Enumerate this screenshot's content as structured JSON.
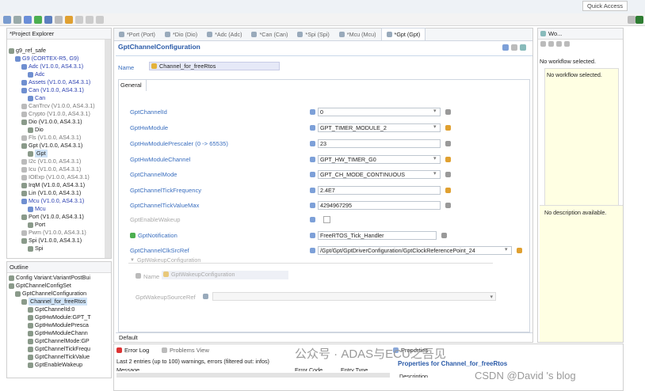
{
  "toolbar": {
    "quick_access": "Quick Access"
  },
  "project_explorer": {
    "title": "*Project Explorer",
    "items": [
      {
        "label": "g9_ref_safe",
        "indent": 0,
        "cls": ""
      },
      {
        "label": "G9 (CORTEX-R5, G9)",
        "indent": 1,
        "cls": "blue"
      },
      {
        "label": "Adc (V1.0.0, AS4.3.1)",
        "indent": 2,
        "cls": "blue"
      },
      {
        "label": "Adc",
        "indent": 3,
        "cls": "blue"
      },
      {
        "label": "Assets (V1.0.0, AS4.3.1)",
        "indent": 2,
        "cls": "blue"
      },
      {
        "label": "Can (V1.0.0, AS4.3.1)",
        "indent": 2,
        "cls": "blue"
      },
      {
        "label": "Can",
        "indent": 3,
        "cls": "blue"
      },
      {
        "label": "CanTrcv (V1.0.0, AS4.3.1)",
        "indent": 2,
        "cls": "gray"
      },
      {
        "label": "Crypto (V1.0.0, AS4.3.1)",
        "indent": 2,
        "cls": "gray"
      },
      {
        "label": "Dio (V1.0.0, AS4.3.1)",
        "indent": 2,
        "cls": ""
      },
      {
        "label": "Dio",
        "indent": 3,
        "cls": ""
      },
      {
        "label": "Fls (V1.0.0, AS4.3.1)",
        "indent": 2,
        "cls": "gray"
      },
      {
        "label": "Gpt (V1.0.0, AS4.3.1)",
        "indent": 2,
        "cls": ""
      },
      {
        "label": "Gpt",
        "indent": 3,
        "cls": "sel"
      },
      {
        "label": "I2c (V1.0.0, AS4.3.1)",
        "indent": 2,
        "cls": "gray"
      },
      {
        "label": "Icu (V1.0.0, AS4.3.1)",
        "indent": 2,
        "cls": "gray"
      },
      {
        "label": "IOExp (V1.0.0, AS4.3.1)",
        "indent": 2,
        "cls": "gray"
      },
      {
        "label": "IrqM (V1.0.0, AS4.3.1)",
        "indent": 2,
        "cls": ""
      },
      {
        "label": "Lin (V1.0.0, AS4.3.1)",
        "indent": 2,
        "cls": ""
      },
      {
        "label": "Mcu (V1.0.0, AS4.3.1)",
        "indent": 2,
        "cls": "blue"
      },
      {
        "label": "Mcu",
        "indent": 3,
        "cls": "blue"
      },
      {
        "label": "Port (V1.0.0, AS4.3.1)",
        "indent": 2,
        "cls": ""
      },
      {
        "label": "Port",
        "indent": 3,
        "cls": ""
      },
      {
        "label": "Pwm (V1.0.0, AS4.3.1)",
        "indent": 2,
        "cls": "gray"
      },
      {
        "label": "Spi (V1.0.0, AS4.3.1)",
        "indent": 2,
        "cls": ""
      },
      {
        "label": "Spi",
        "indent": 3,
        "cls": ""
      }
    ]
  },
  "outline": {
    "title": "Outline",
    "items": [
      {
        "label": "Config Variant:VariantPostBui",
        "indent": 0,
        "cls": ""
      },
      {
        "label": "GptChannelConfigSet",
        "indent": 0,
        "cls": ""
      },
      {
        "label": "GptChannelConfiguration",
        "indent": 1,
        "cls": ""
      },
      {
        "label": "Channel_for_freeRtos",
        "indent": 2,
        "cls": "sel"
      },
      {
        "label": "GptChannelId:0",
        "indent": 3,
        "cls": ""
      },
      {
        "label": "GptHwModule:GPT_T",
        "indent": 3,
        "cls": ""
      },
      {
        "label": "GptHwModulePresca",
        "indent": 3,
        "cls": ""
      },
      {
        "label": "GptHwModuleChann",
        "indent": 3,
        "cls": ""
      },
      {
        "label": "GptChannelMode:GP",
        "indent": 3,
        "cls": ""
      },
      {
        "label": "GptChannelTickFrequ",
        "indent": 3,
        "cls": ""
      },
      {
        "label": "GptChannelTickValue",
        "indent": 3,
        "cls": ""
      },
      {
        "label": "GptEnableWakeup",
        "indent": 3,
        "cls": ""
      }
    ]
  },
  "editor": {
    "tabs": [
      {
        "label": "*Port (Port)",
        "sel": false
      },
      {
        "label": "*Dio (Dio)",
        "sel": false
      },
      {
        "label": "*Adc (Adc)",
        "sel": false
      },
      {
        "label": "*Can (Can)",
        "sel": false
      },
      {
        "label": "*Spi (Spi)",
        "sel": false
      },
      {
        "label": "*Mcu (Mcu)",
        "sel": false
      },
      {
        "label": "*Gpt (Gpt)",
        "sel": true
      }
    ],
    "section_title": "GptChannelConfiguration",
    "name_label": "Name",
    "name_value": "Channel_for_freeRtos",
    "general_tab": "General",
    "default_tab": "Default",
    "params": [
      {
        "label": "GptChannelId",
        "value": "0",
        "dis": false
      },
      {
        "label": "GptHwModule",
        "value": "GPT_TIMER_MODULE_2",
        "dis": false
      },
      {
        "label": "GptHwModulePrescaler (0 -> 65535)",
        "value": "23",
        "dis": false
      },
      {
        "label": "GptHwModuleChannel",
        "value": "GPT_HW_TIMER_G0",
        "dis": false
      },
      {
        "label": "GptChannelMode",
        "value": "GPT_CH_MODE_CONTINUOUS",
        "dis": false
      },
      {
        "label": "GptChannelTickFrequency",
        "value": "2.4E7",
        "dis": false
      },
      {
        "label": "GptChannelTickValueMax",
        "value": "4294967295",
        "dis": false
      },
      {
        "label": "GptEnableWakeup",
        "value": "",
        "dis": true
      },
      {
        "label": "GptNotification",
        "value": "FreeRTOS_Tick_Handler",
        "dis": false
      },
      {
        "label": "GptChannelClkSrcRef",
        "value": "/Gpt/Gpt/GptDriverConfiguration/GptClockReferencePoint_24",
        "dis": false
      }
    ],
    "wakeup_group": "GptWakeupConfiguration",
    "wakeup_name_label": "Name",
    "wakeup_name_value": "GptWakeupConfiguration",
    "wakeup_source_label": "GptWakeupSourceRef"
  },
  "workflow": {
    "title": "Wo...",
    "status_top": "No workflow selected.",
    "status_box": "No workflow selected.",
    "description": "No description available."
  },
  "bottom": {
    "error_tab": "Error Log",
    "problems_tab": "Problems View",
    "summary": "Last 2 entries (up to 100) warnings, errors (filtered out: infos)",
    "col_message": "Message",
    "col_error_code": "Error Code",
    "col_entry_type": "Entry Type",
    "properties_tab": "Properties",
    "properties_title": "Properties for Channel_for_freeRtos",
    "description_col": "Description"
  },
  "watermark": {
    "line1": "公众号 · ADAS与ECU之吾见",
    "line2": "CSDN @David 's blog"
  },
  "colors": {
    "accent": "#3b6fbf",
    "selection": "#cfe3f7",
    "yellow_panel": "#ffffe3"
  }
}
